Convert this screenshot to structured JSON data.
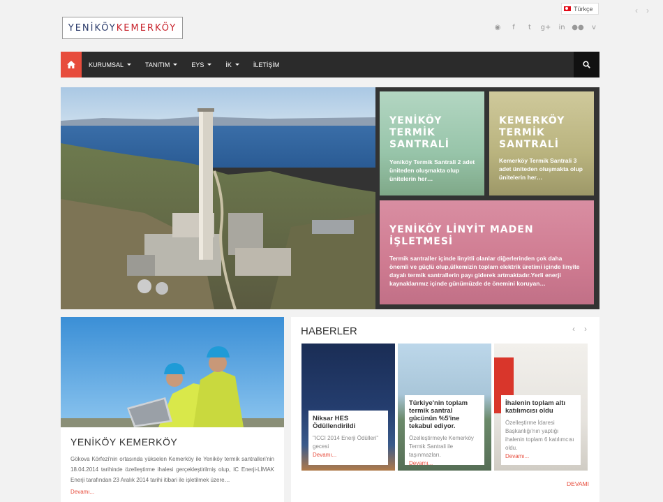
{
  "brand": {
    "part1": "YENİKÖY",
    "part2": "KEMERKÖY",
    "color1": "#2a3a6a",
    "color2": "#c8232c"
  },
  "language": {
    "label": "Türkçe"
  },
  "top_arrows": {
    "prev": "‹",
    "next": "›"
  },
  "social_icons": [
    "rss-icon",
    "facebook-icon",
    "twitter-icon",
    "google-plus-icon",
    "linkedin-icon",
    "flickr-icon",
    "vimeo-icon"
  ],
  "nav": {
    "items": [
      {
        "label": "KURUMSAL",
        "dropdown": true
      },
      {
        "label": "TANITIM",
        "dropdown": true
      },
      {
        "label": "EYS",
        "dropdown": true
      },
      {
        "label": "İK",
        "dropdown": true
      },
      {
        "label": "İLETİŞİM",
        "dropdown": false
      }
    ],
    "accent": "#e74c3c"
  },
  "tiles": [
    {
      "title": "YENİKÖY TERMİK SANTRALİ",
      "text": "Yeniköy Termik Santrali 2 adet üniteden oluşmakta olup ünitelerin her…",
      "color": "#a8d0b8"
    },
    {
      "title": "KEMERKÖY TERMİK SANTRALİ",
      "text": "Kemerköy Termik Santrali 3 adet üniteden oluşmakta olup ünitelerin her…",
      "color": "#c6c28c"
    },
    {
      "title": "YENİKÖY LİNYİT MADEN İŞLETMESİ",
      "text": "Termik santraller içinde linyitli olanlar diğerlerinden çok daha önemli ve güçlü olup,ülkemizin toplam elektrik üretimi içinde linyite dayalı termik santrallerin payı giderek artmaktadır.Yerli enerji kaynaklarımız içinde günümüzde de önemini koruyan…",
      "color": "#d8869a"
    }
  ],
  "about": {
    "title": "YENİKÖY KEMERKÖY",
    "text": "Gökova Körfezi'nin ortasında yükselen Kemerköy ile Yeniköy termik santralleri'nin 18.04.2014 tarihinde özelleştirme ihalesi gerçekleştirilmiş olup, IC Enerji-LİMAK Enerji tarafından 23 Aralık 2014 tarihi itibari ile işletilmek üzere…",
    "more": "Devamı..."
  },
  "news": {
    "heading": "HABERLER",
    "prev": "‹",
    "next": "›",
    "items": [
      {
        "title": "Niksar HES Ödüllendirildi",
        "text": "\"ICCI 2014 Enerji Ödülleri\" gecesi",
        "more": "Devamı..."
      },
      {
        "title": "Türkiye'nin toplam termik santral gücünün %5'ine tekabul ediyor.",
        "text": "Özelleştirmeyle Kemerköy Termik Santrali ile taşınmazları.",
        "more": "Devamı..."
      },
      {
        "title": "İhalenin toplam altı katılımcısı oldu",
        "text": "Özelleştirme İdaresi Başkanlığı'nın yaptığı ihalenin toplam 6 katılımcısı oldu.",
        "more": "Devamı..."
      }
    ],
    "all": "DEVAMI"
  }
}
